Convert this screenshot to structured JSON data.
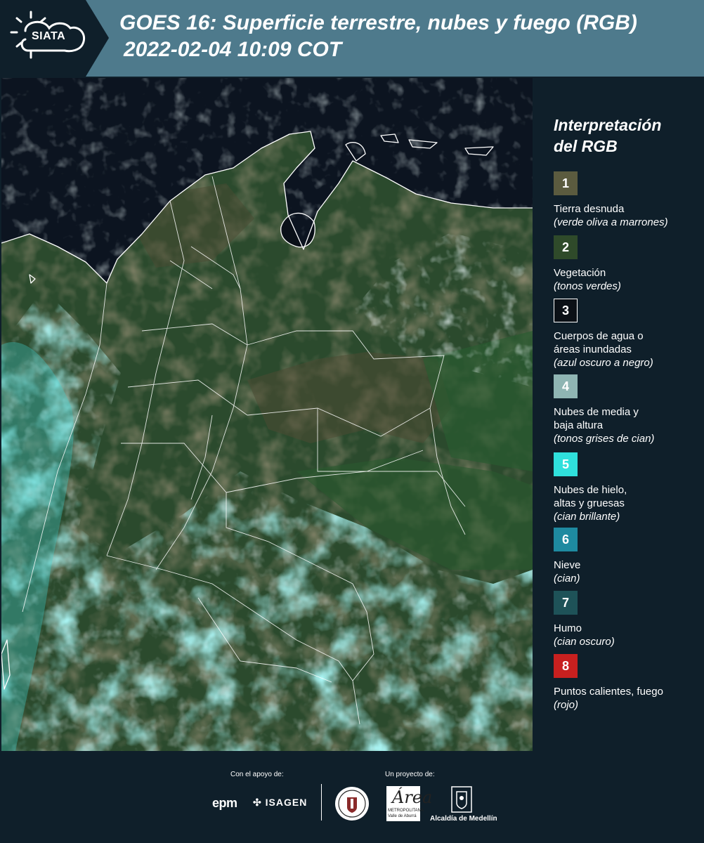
{
  "header": {
    "logo_text": "SIATA",
    "title_line1": "GOES 16: Superficie terrestre, nubes y fuego (RGB)",
    "title_line2": "2022-02-04 10:09 COT"
  },
  "legend": {
    "title_line1": "Interpretación",
    "title_line2": "del RGB",
    "items": [
      {
        "num": "1",
        "label": "Tierra desnuda",
        "desc": "(verde oliva a marrones)",
        "color": "#5b5b3f"
      },
      {
        "num": "2",
        "label": "Vegetación",
        "desc": "(tonos verdes)",
        "color": "#2f4a2a"
      },
      {
        "num": "3",
        "label": "Cuerpos de agua o",
        "label2": "áreas inundadas",
        "desc": "(azul oscuro a negro)",
        "color": "#0b1016"
      },
      {
        "num": "4",
        "label": "Nubes de media y",
        "label2": "baja altura",
        "desc": "(tonos grises de cian)",
        "color": "#8fb5b3"
      },
      {
        "num": "5",
        "label": "Nubes de hielo,",
        "label2": "altas y gruesas",
        "desc": "(cian brillante)",
        "color": "#2fe0dc"
      },
      {
        "num": "6",
        "label": "Nieve",
        "desc": "(cian)",
        "color": "#1e8aa0"
      },
      {
        "num": "7",
        "label": "Humo",
        "desc": "(cian oscuro)",
        "color": "#1e5258"
      },
      {
        "num": "8",
        "label": "Puntos calientes, fuego",
        "desc": "(rojo)",
        "color": "#c8201f"
      }
    ]
  },
  "footer": {
    "support_label": "Con el apoyo de:",
    "project_label": "Un proyecto de:",
    "epm": "epm",
    "isagen": "ISAGEN",
    "area_logo": "Área",
    "area_sub1": "METROPOLITANA",
    "area_sub2": "Valle de Aburrá",
    "alcaldia": "Alcaldía de Medellín"
  }
}
